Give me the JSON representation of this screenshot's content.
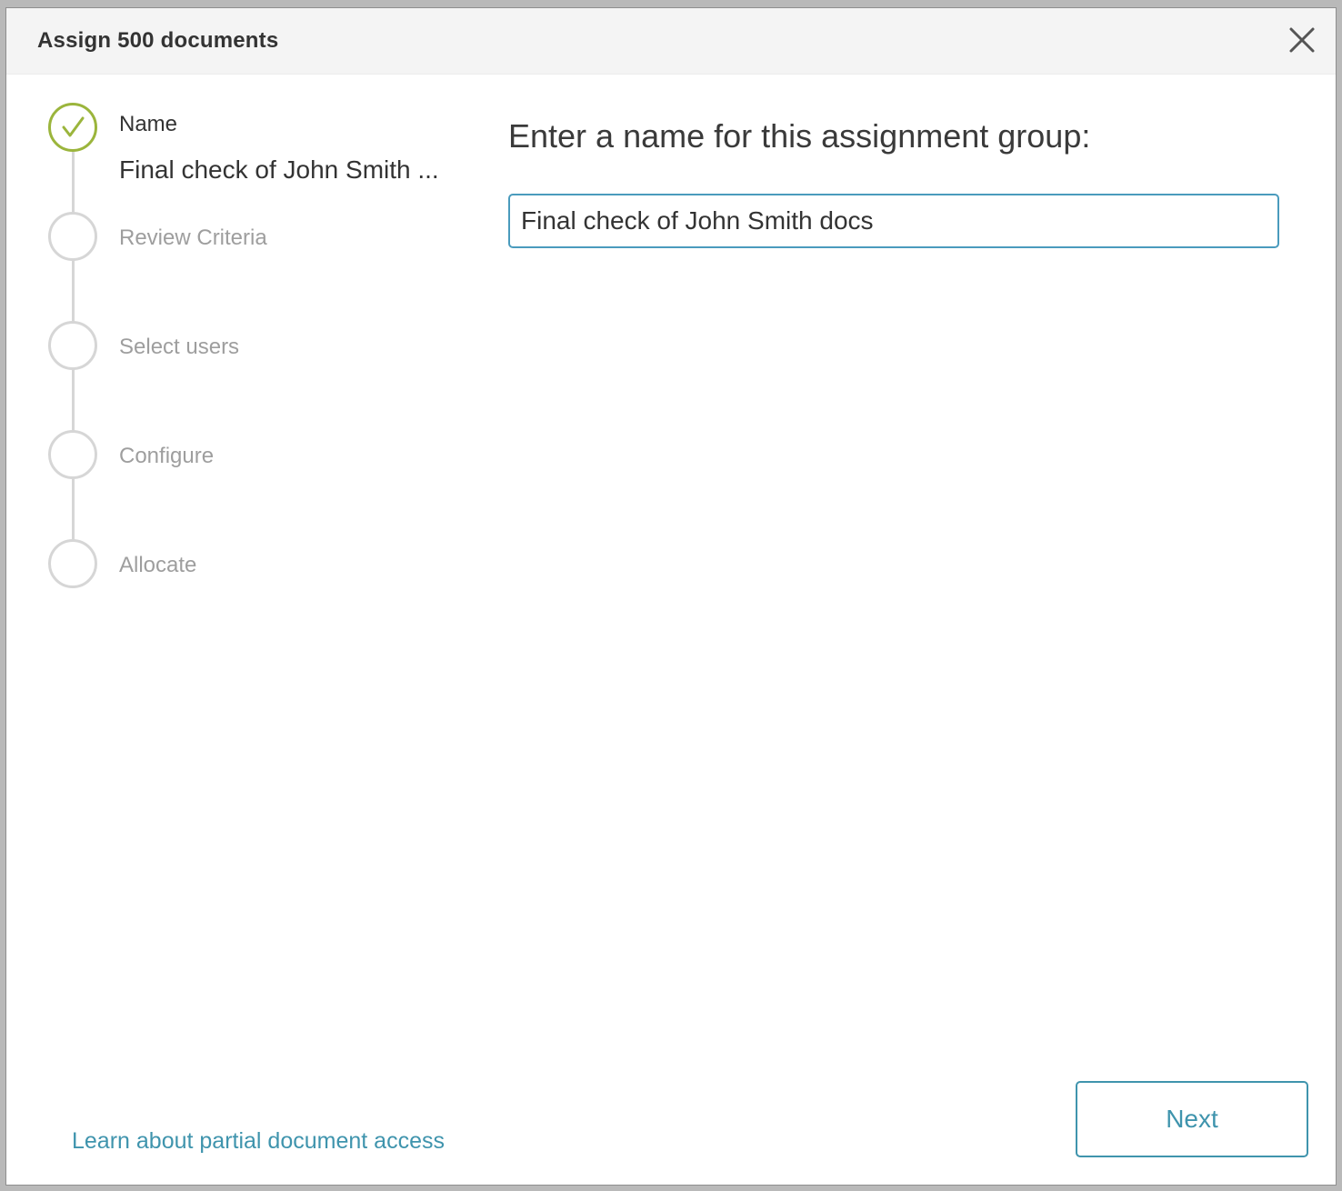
{
  "dialog": {
    "title": "Assign 500 documents",
    "close_icon": "close-icon"
  },
  "steps": [
    {
      "label": "Name",
      "sublabel": "Final check of John Smith ...",
      "state": "complete",
      "icon": "check-icon"
    },
    {
      "label": "Review Criteria",
      "state": "pending"
    },
    {
      "label": "Select users",
      "state": "pending"
    },
    {
      "label": "Configure",
      "state": "pending"
    },
    {
      "label": "Allocate",
      "state": "pending"
    }
  ],
  "main": {
    "heading": "Enter a name for this assignment group:",
    "name_input_value": "Final check of John Smith docs"
  },
  "footer": {
    "learn_link": "Learn about partial document access",
    "next_label": "Next"
  },
  "colors": {
    "accent": "#3f94ad",
    "complete": "#9bb53c",
    "pending": "#d6d6d6"
  }
}
